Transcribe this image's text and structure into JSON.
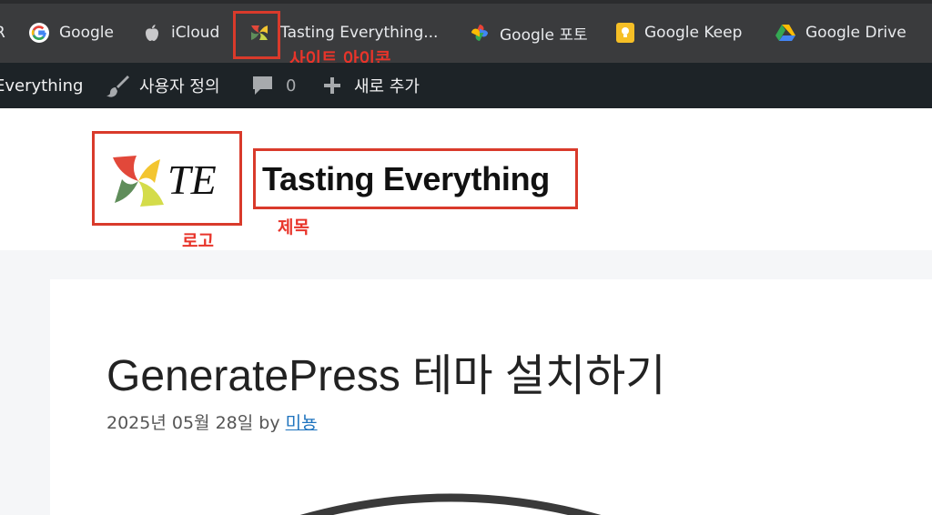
{
  "bookmarks": {
    "items": [
      {
        "label": "R",
        "icon": "bookmark-edge-icon"
      },
      {
        "label": "Google",
        "icon": "google-g-icon"
      },
      {
        "label": "iCloud",
        "icon": "apple-icon"
      },
      {
        "label": "Tasting Everything...",
        "icon": "te-site-favicon"
      },
      {
        "label": "Google 포토",
        "icon": "google-photos-pinwheel-icon"
      },
      {
        "label": "Google Keep",
        "icon": "google-keep-bulb-icon"
      },
      {
        "label": "Google Drive",
        "icon": "google-drive-triangle-icon"
      }
    ]
  },
  "annotations": {
    "site_icon": "사이트 아이콘",
    "logo": "로고",
    "title": "제목",
    "color": "#d93a2b"
  },
  "adminbar": {
    "site_name": "Everything",
    "customize": "사용자 정의",
    "comments_count": "0",
    "new": "새로 추가"
  },
  "header": {
    "logo_text": "TE",
    "site_title": "Tasting Everything"
  },
  "post": {
    "title": "GeneratePress 테마 설치하기",
    "date": "2025년 05월 28일",
    "by": "by",
    "author": "미뇽"
  },
  "colors": {
    "bookmarks_bg": "#3a3b3d",
    "adminbar_bg": "#1d2327",
    "link": "#1e73be",
    "page_bg": "#f5f6f8"
  }
}
